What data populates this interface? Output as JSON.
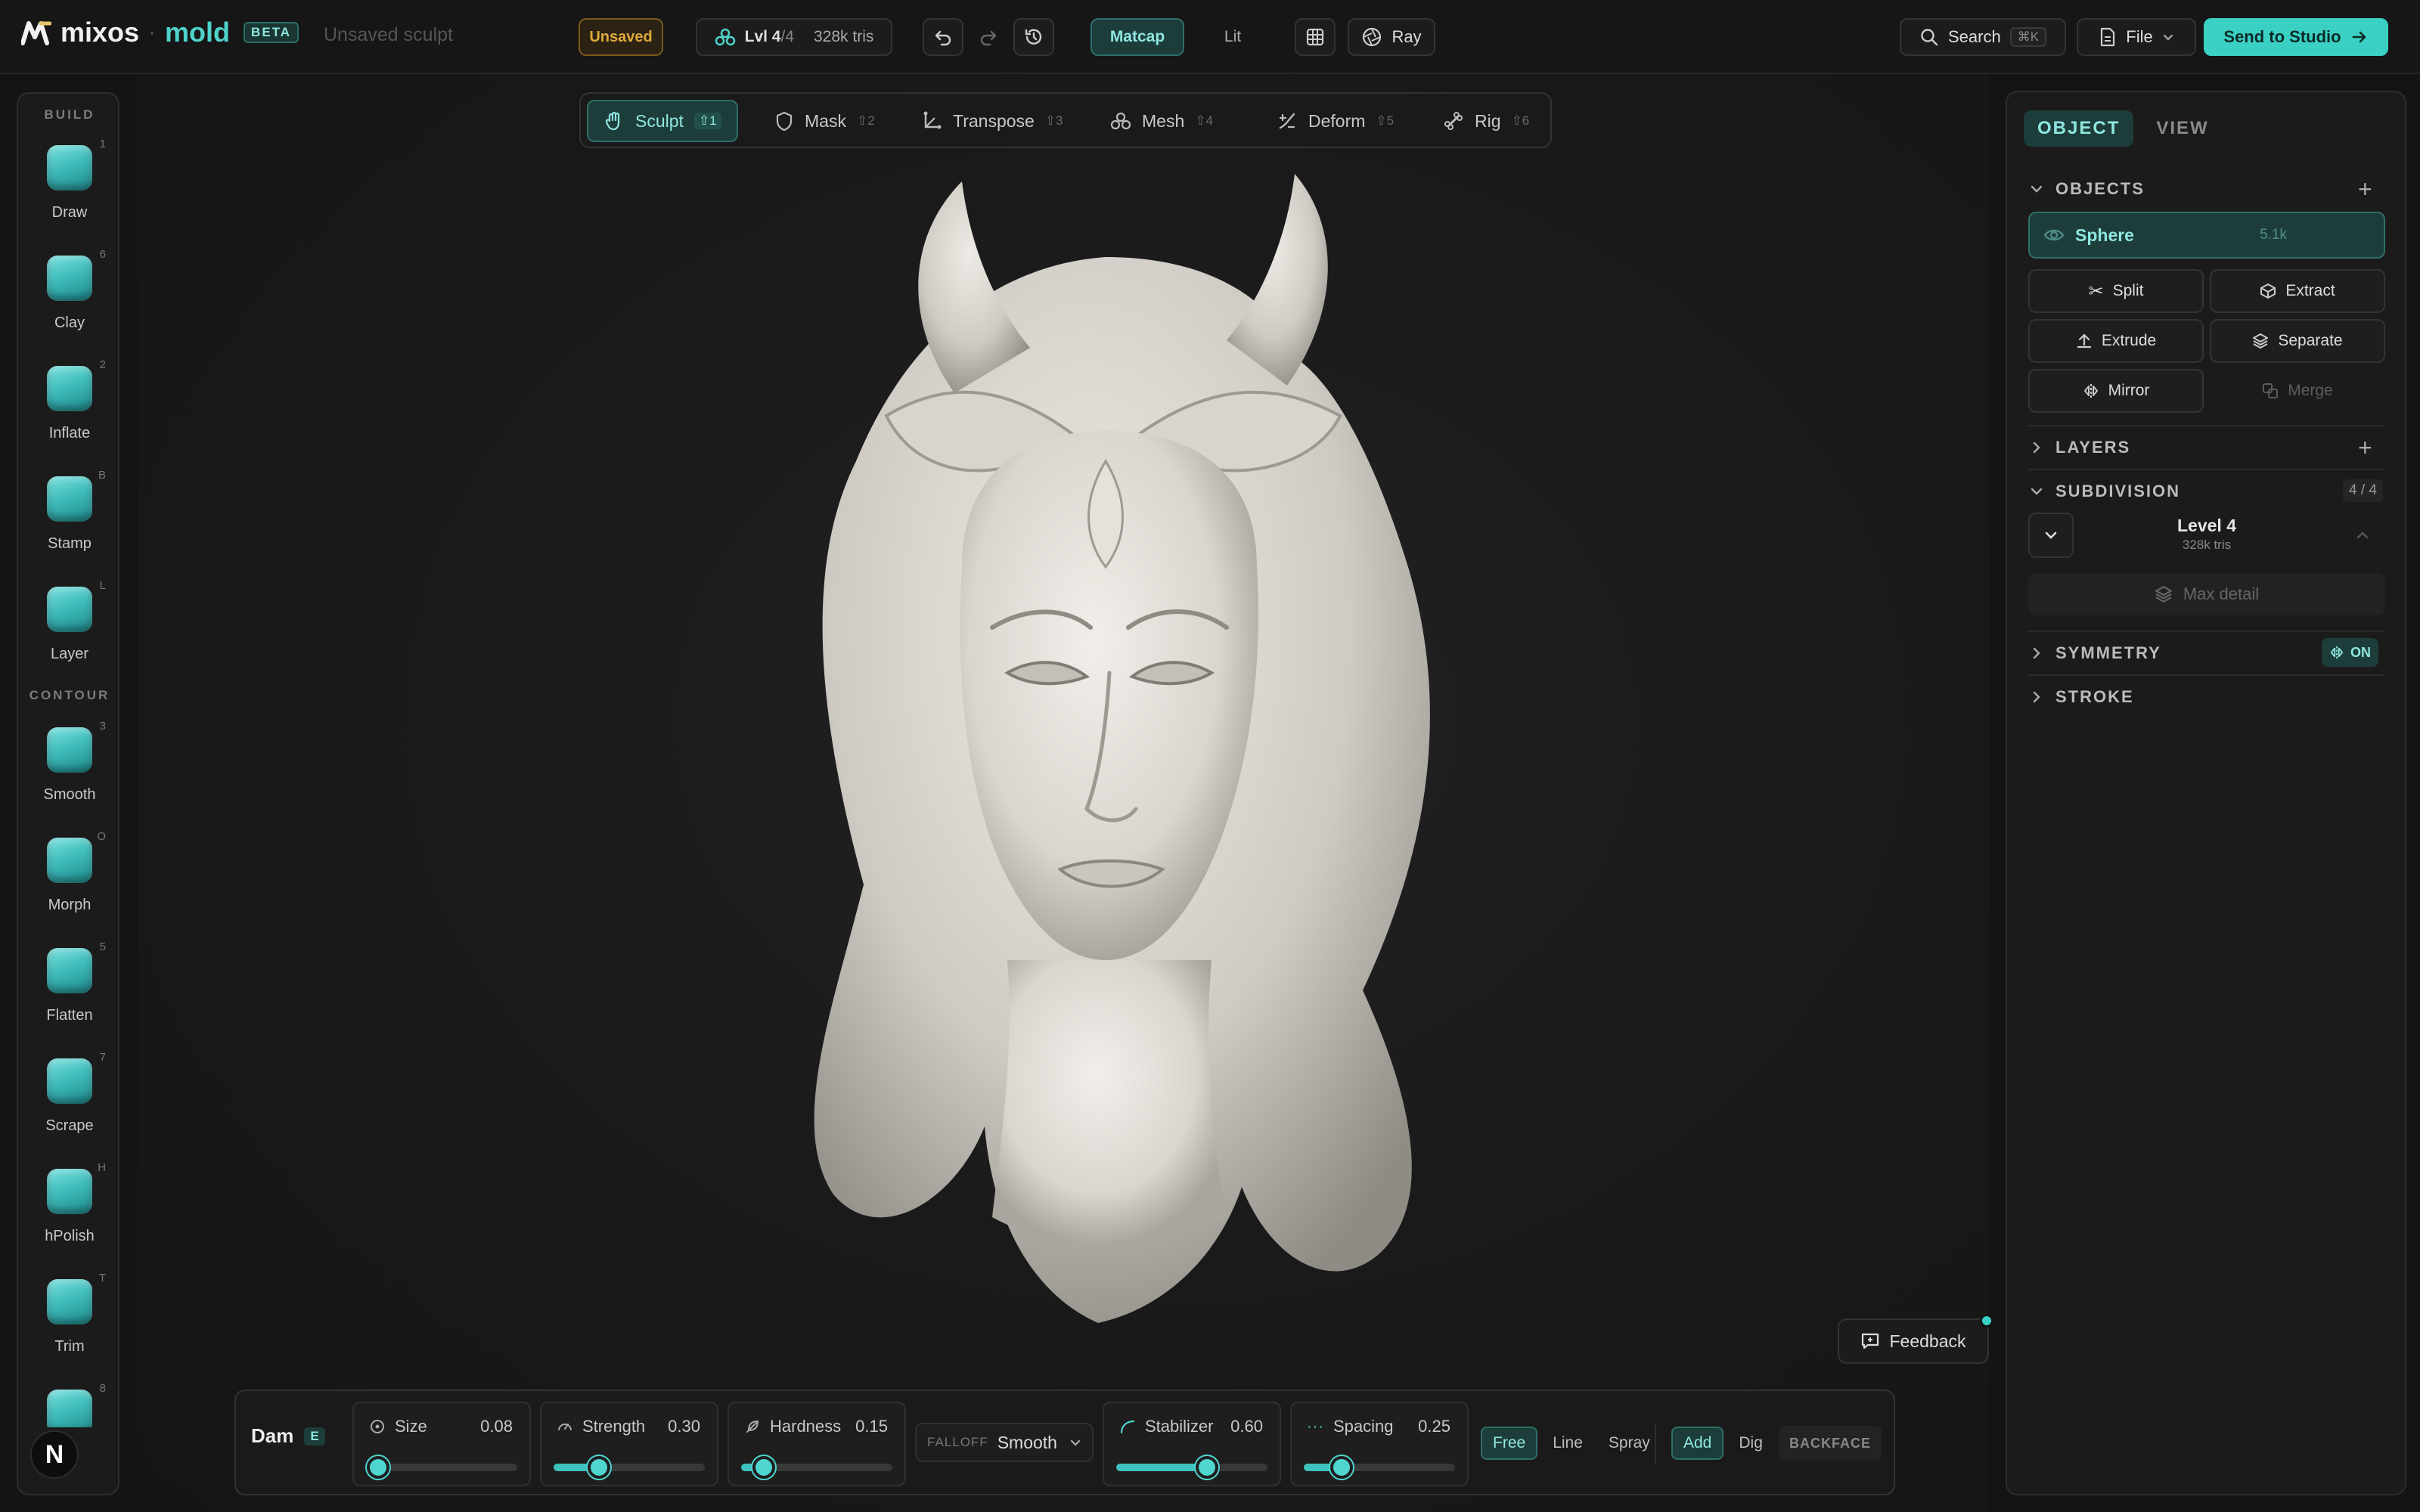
{
  "colors": {
    "accent": "#3cc3bd",
    "background": "#141414",
    "panel": "#1b1b1b",
    "unsaved": "#e0a93b"
  },
  "header": {
    "logo": "mixos",
    "app": "mold",
    "badge": "BETA",
    "document": "Unsaved sculpt",
    "status": "Unsaved",
    "level": "Lvl 4",
    "level_of": "/4",
    "tris": "328k tris",
    "render_modes": [
      "Matcap",
      "Lit"
    ],
    "ray": "Ray",
    "search": "Search",
    "search_shortcut": "⌘K",
    "file": "File",
    "send": "Send to Studio"
  },
  "modes": [
    {
      "label": "Sculpt",
      "key": "⇧1",
      "icon": "hand-icon"
    },
    {
      "label": "Mask",
      "key": "⇧2",
      "icon": "shield-icon"
    },
    {
      "label": "Transpose",
      "key": "⇧3",
      "icon": "transpose-icon"
    },
    {
      "label": "Mesh",
      "key": "⇧4",
      "icon": "mesh-icon"
    },
    {
      "label": "Deform",
      "key": "⇧5",
      "icon": "deform-icon"
    },
    {
      "label": "Rig",
      "key": "⇧6",
      "icon": "bone-icon"
    }
  ],
  "left": {
    "build_label": "BUILD",
    "contour_label": "CONTOUR",
    "build": [
      {
        "label": "Draw",
        "key": "1"
      },
      {
        "label": "Clay",
        "key": "6"
      },
      {
        "label": "Inflate",
        "key": "2"
      },
      {
        "label": "Stamp",
        "key": "B"
      },
      {
        "label": "Layer",
        "key": "L"
      }
    ],
    "contour": [
      {
        "label": "Smooth",
        "key": "3"
      },
      {
        "label": "Morph",
        "key": "O"
      },
      {
        "label": "Flatten",
        "key": "5"
      },
      {
        "label": "Scrape",
        "key": "7"
      },
      {
        "label": "hPolish",
        "key": "H"
      },
      {
        "label": "Trim",
        "key": "T"
      },
      {
        "label": "",
        "key": "8"
      }
    ],
    "avatar": "N"
  },
  "right": {
    "tabs": [
      "OBJECT",
      "VIEW"
    ],
    "objects_label": "OBJECTS",
    "object_name": "Sphere",
    "object_count": "5.1k",
    "actions": [
      "Split",
      "Extract",
      "Extrude",
      "Separate",
      "Mirror",
      "Merge"
    ],
    "layers_label": "LAYERS",
    "subdivision_label": "SUBDIVISION",
    "subdivision_count": "4 / 4",
    "level_label": "Level 4",
    "level_tris": "328k tris",
    "max_detail": "Max detail",
    "symmetry_label": "SYMMETRY",
    "symmetry_state": "ON",
    "stroke_label": "STROKE"
  },
  "brush": {
    "name": "Dam",
    "key": "E",
    "params": [
      {
        "label": "Size",
        "value": "0.08",
        "level": 0.08
      },
      {
        "label": "Strength",
        "value": "0.30",
        "level": 0.3
      },
      {
        "label": "Hardness",
        "value": "0.15",
        "level": 0.15
      }
    ],
    "falloff_label": "FALLOFF",
    "falloff_value": "Smooth",
    "params2": [
      {
        "label": "Stabilizer",
        "value": "0.60",
        "level": 0.6
      },
      {
        "label": "Spacing",
        "value": "0.25",
        "level": 0.25
      }
    ],
    "stroke_modes": [
      "Free",
      "Line",
      "Spray"
    ],
    "ops": [
      "Add",
      "Dig"
    ],
    "backface": "BACKFACE"
  },
  "feedback": "Feedback"
}
